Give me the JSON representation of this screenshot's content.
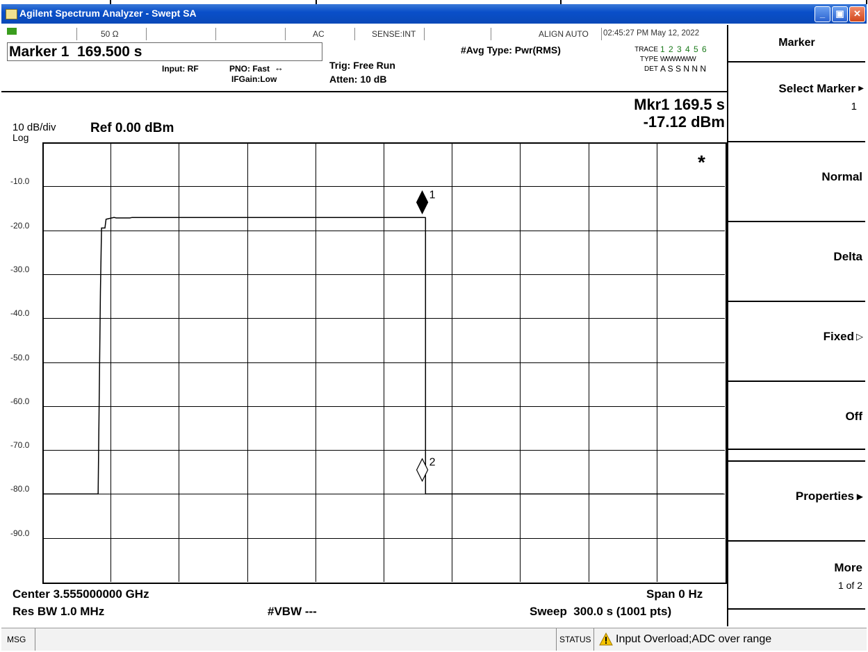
{
  "window": {
    "title": "Agilent Spectrum Analyzer - Swept SA"
  },
  "header": {
    "impedance": "50 Ω",
    "coupling": "AC",
    "sense": "SENSE:INT",
    "align": "ALIGN AUTO",
    "datetime": "02:45:27 PM May 12, 2022",
    "marker_readout": "Marker 1  169.500 s",
    "input": "Input: RF",
    "pno": "PNO: Fast",
    "ifgain": "IFGain:Low",
    "trig": "Trig: Free Run",
    "atten": "Atten: 10 dB",
    "avg_type": "#Avg Type: Pwr(RMS)",
    "trace_label": "TRACE",
    "trace_nums": "1 2 3 4 5 6",
    "type_label": "TYPE",
    "type_vals": "WWWWWW",
    "det_label": "DET",
    "det_vals": "A S S N N N"
  },
  "display": {
    "scale": "10 dB/div",
    "log": "Log",
    "ref": "Ref 0.00 dBm",
    "mkr_line1": "Mkr1 169.5 s",
    "mkr_line2": "-17.12 dBm",
    "star": "*",
    "marker1_label": "1",
    "marker2_label": "2",
    "center": "Center 3.555000000 GHz",
    "span": "Span 0 Hz",
    "rbw": "Res BW 1.0 MHz",
    "vbw": "#VBW ---",
    "sweep": "Sweep  300.0 s (1001 pts)"
  },
  "chart_data": {
    "type": "line",
    "ylim": [
      -100,
      0
    ],
    "y_ticks": [
      "-10.0",
      "-20.0",
      "-30.0",
      "-40.0",
      "-50.0",
      "-60.0",
      "-70.0",
      "-80.0",
      "-90.0"
    ],
    "xlim": [
      0,
      300
    ],
    "series": [
      {
        "values_x": [
          0,
          24,
          25,
          25.5,
          27,
          27.5,
          30,
          31,
          32,
          38,
          39,
          42,
          163,
          168,
          168.5,
          168.5,
          300
        ],
        "values_y": [
          -80,
          -80,
          -34,
          -19.5,
          -19.5,
          -17.5,
          -17.2,
          -17.1,
          -17.2,
          -17.2,
          -17.1,
          -17.1,
          -17.1,
          -17.1,
          -17.12,
          -80,
          -80
        ]
      }
    ],
    "markers": [
      {
        "label": "1",
        "x": 169.5,
        "y": -17.12,
        "style": "filled"
      },
      {
        "label": "2",
        "x": 169.5,
        "y": -78.0,
        "style": "hollow"
      }
    ]
  },
  "softkeys": {
    "menu_title": "Marker",
    "select_marker": "Select Marker",
    "select_marker_value": "1",
    "normal": "Normal",
    "delta": "Delta",
    "fixed": "Fixed",
    "off": "Off",
    "properties": "Properties",
    "more": "More",
    "more_page": "1 of 2"
  },
  "statusbar": {
    "msg": "MSG",
    "status": "STATUS",
    "message": "Input Overload;ADC over range"
  }
}
